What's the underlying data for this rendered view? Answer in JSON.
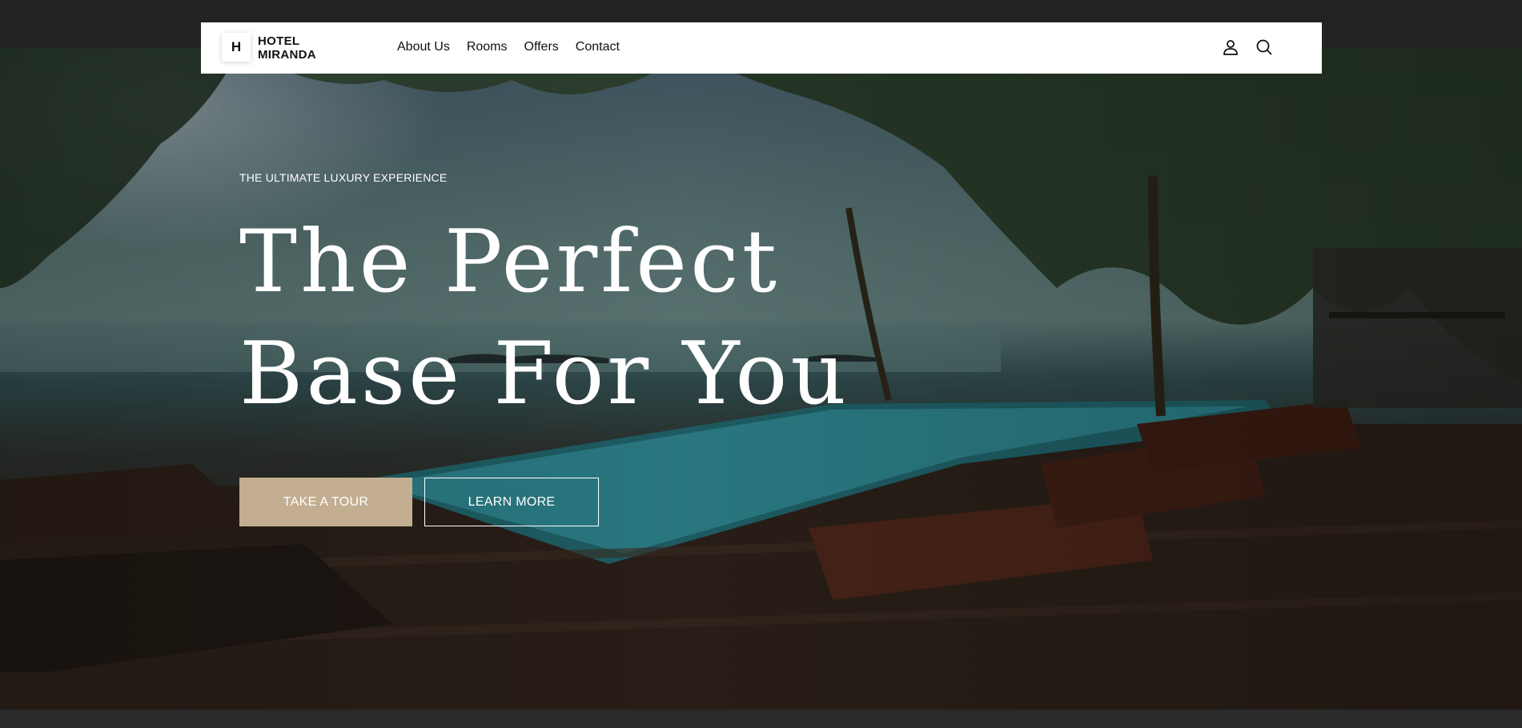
{
  "brand": {
    "mark": "H",
    "name_line1": "HOTEL",
    "name_line2": "MIRANDA"
  },
  "nav": {
    "items": [
      {
        "label": "About Us"
      },
      {
        "label": "Rooms"
      },
      {
        "label": "Offers"
      },
      {
        "label": "Contact"
      }
    ],
    "icons": [
      "user-icon",
      "search-icon"
    ]
  },
  "hero": {
    "eyebrow": "THE ULTIMATE LUXURY EXPERIENCE",
    "headline_line1": "The Perfect",
    "headline_line2": "Base For You",
    "primary_button": "TAKE A TOUR",
    "secondary_button": "LEARN MORE",
    "image": "tropical resort pool with sun loungers and palm trees"
  },
  "colors": {
    "accent": "#c3ae91",
    "navbar_bg": "#ffffff",
    "page_bg": "#222222",
    "text_light": "#ffffff"
  }
}
